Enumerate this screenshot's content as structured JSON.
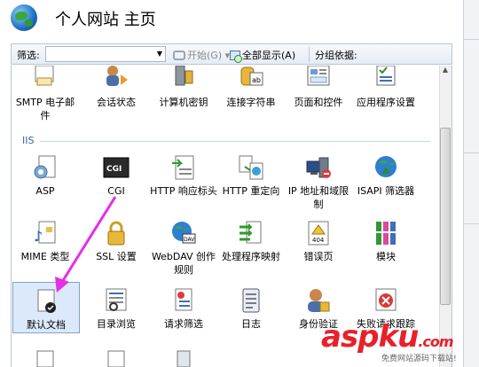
{
  "header": {
    "title": "个人网站 主页"
  },
  "toolbar": {
    "filter_label": "筛选:",
    "filter_value": "",
    "start_label": "开始(G)",
    "show_all_label": "全部显示(A)",
    "group_by_label": "分组依据:"
  },
  "top_row": [
    {
      "label": "SMTP 电子邮件",
      "icon": "smtp-icon"
    },
    {
      "label": "会话状态",
      "icon": "session-icon"
    },
    {
      "label": "计算机密钥",
      "icon": "machine-key-icon"
    },
    {
      "label": "连接字符串",
      "icon": "connection-string-icon"
    },
    {
      "label": "页面和控件",
      "icon": "pages-controls-icon"
    },
    {
      "label": "应用程序设置",
      "icon": "app-settings-icon"
    }
  ],
  "group_iis": "IIS",
  "iis_row1": [
    {
      "label": "ASP",
      "icon": "asp-icon"
    },
    {
      "label": "CGI",
      "icon": "cgi-icon"
    },
    {
      "label": "HTTP 响应标头",
      "icon": "http-headers-icon"
    },
    {
      "label": "HTTP 重定向",
      "icon": "http-redirect-icon"
    },
    {
      "label": "IP 地址和域限制",
      "icon": "ip-restrict-icon"
    },
    {
      "label": "ISAPI 筛选器",
      "icon": "isapi-icon"
    }
  ],
  "iis_row2": [
    {
      "label": "MIME 类型",
      "icon": "mime-icon"
    },
    {
      "label": "SSL 设置",
      "icon": "ssl-lock-icon"
    },
    {
      "label": "WebDAV 创作规则",
      "icon": "webdav-icon"
    },
    {
      "label": "处理程序映射",
      "icon": "handler-icon"
    },
    {
      "label": "错误页",
      "icon": "error-page-icon"
    },
    {
      "label": "模块",
      "icon": "modules-icon"
    }
  ],
  "iis_row3": [
    {
      "label": "默认文档",
      "icon": "default-document-icon"
    },
    {
      "label": "目录浏览",
      "icon": "directory-browsing-icon"
    },
    {
      "label": "请求筛选",
      "icon": "request-filtering-icon"
    },
    {
      "label": "日志",
      "icon": "logging-icon"
    },
    {
      "label": "身份验证",
      "icon": "authentication-icon"
    },
    {
      "label": "失败请求跟踪",
      "icon": "failed-request-icon"
    }
  ],
  "watermark": {
    "main": "aspku",
    "dot": ".com",
    "sub": "免费网站源码下载站!"
  }
}
